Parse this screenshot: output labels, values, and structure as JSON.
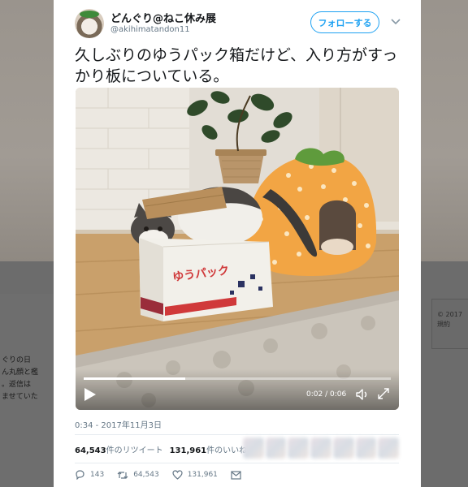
{
  "background": {
    "left_text": "ぐりの日\nん丸顔と檻\n。返信は\nませていた",
    "right_text": "© 2017\n規約"
  },
  "tweet": {
    "display_name": "どんぐり@ねこ休み展",
    "screen_name": "@akihimatandon11",
    "follow_label": "フォローする",
    "text": "久しぶりのゆうパック箱だけど、入り方がすっかり板についている。",
    "timestamp": "0:34 - 2017年11月3日",
    "box_label": "ゆうパック",
    "video": {
      "time": "0:02 / 0:06",
      "progress": 0.33
    },
    "stats": {
      "retweets_count": "64,543",
      "retweets_label": "件のリツイート",
      "likes_count": "131,961",
      "likes_label": "件のいいね"
    },
    "actions": {
      "replies": "143",
      "retweets": "64,543",
      "likes": "131,961"
    }
  },
  "icons": [
    "avatar",
    "chevron-down-icon",
    "play-icon",
    "volume-icon",
    "fullscreen-icon",
    "reply-icon",
    "retweet-icon",
    "like-icon",
    "dm-icon"
  ],
  "colors": {
    "accent": "#1da1f2",
    "muted_text": "#657786",
    "overlay": "#6d6d6d"
  }
}
